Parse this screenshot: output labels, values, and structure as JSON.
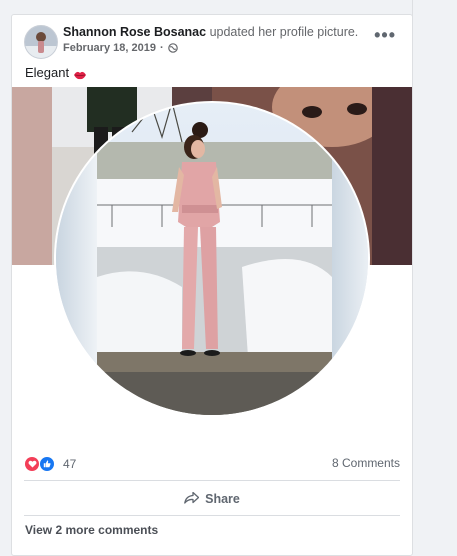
{
  "post": {
    "author": "Shannon Rose Bosanac",
    "action": "updated her profile picture.",
    "date": "February 18, 2019",
    "separator": "·",
    "privacy_icon": "globe-icon",
    "more_label": "•••",
    "caption": "Elegant",
    "caption_emoji": "lips-icon"
  },
  "footer": {
    "reaction_icons": [
      "love-icon",
      "like-icon"
    ],
    "reaction_count": "47",
    "comments_label": "8 Comments",
    "share_label": "Share",
    "view_more_comments": "View 2 more comments"
  },
  "colors": {
    "like_blue": "#1877f2",
    "love_red": "#f33e58",
    "text_gray": "#65676b"
  }
}
